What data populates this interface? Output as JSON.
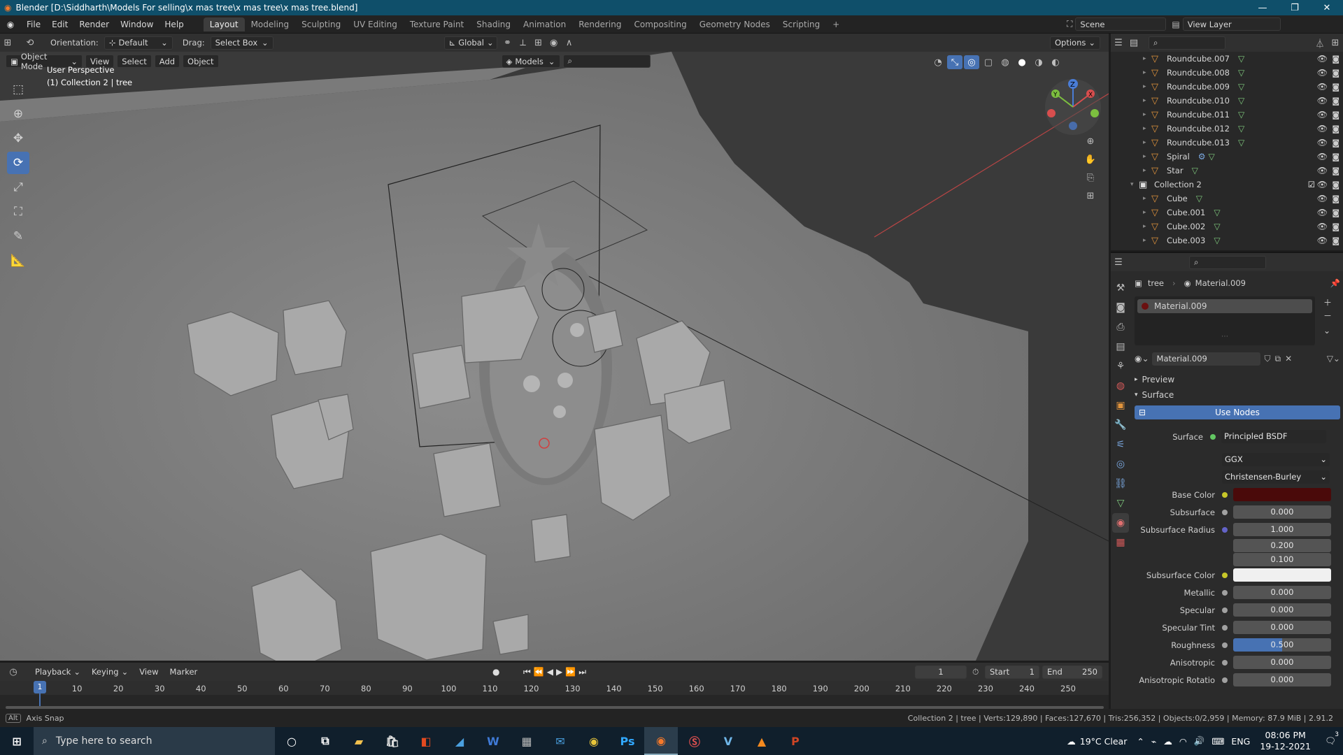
{
  "window": {
    "title": "Blender [D:\\Siddharth\\Models For selling\\x mas tree\\x mas tree\\x mas tree.blend]",
    "minimize": "—",
    "maximize": "❐",
    "close": "✕"
  },
  "menu": {
    "items": [
      "File",
      "Edit",
      "Render",
      "Window",
      "Help"
    ]
  },
  "workspaces": {
    "tabs": [
      "Layout",
      "Modeling",
      "Sculpting",
      "UV Editing",
      "Texture Paint",
      "Shading",
      "Animation",
      "Rendering",
      "Compositing",
      "Geometry Nodes",
      "Scripting"
    ],
    "active": "Layout",
    "add": "+"
  },
  "scene": {
    "label": "Scene",
    "view_layer": "View Layer"
  },
  "tool_header": {
    "orientation_label": "Orientation:",
    "orientation_value": "Default",
    "drag_label": "Drag:",
    "drag_value": "Select Box",
    "transform": "Global",
    "options": "Options"
  },
  "viewport_header": {
    "mode": "Object Mode",
    "view": "View",
    "select": "Select",
    "add": "Add",
    "object": "Object",
    "collection_filter": "Models"
  },
  "viewport": {
    "perspective": "User Perspective",
    "context": "(1) Collection 2 | tree",
    "gizmo_axes": [
      "Z",
      "Y",
      "X"
    ]
  },
  "outliner": {
    "rows": [
      {
        "name": "Roundcube.007",
        "type": "object"
      },
      {
        "name": "Roundcube.008",
        "type": "object"
      },
      {
        "name": "Roundcube.009",
        "type": "object"
      },
      {
        "name": "Roundcube.010",
        "type": "object"
      },
      {
        "name": "Roundcube.011",
        "type": "object"
      },
      {
        "name": "Roundcube.012",
        "type": "object"
      },
      {
        "name": "Roundcube.013",
        "type": "object"
      },
      {
        "name": "Spiral",
        "type": "object"
      },
      {
        "name": "Star",
        "type": "object"
      },
      {
        "name": "Collection 2",
        "type": "collection"
      },
      {
        "name": "Cube",
        "type": "object"
      },
      {
        "name": "Cube.001",
        "type": "object"
      },
      {
        "name": "Cube.002",
        "type": "object"
      },
      {
        "name": "Cube.003",
        "type": "object"
      }
    ]
  },
  "properties": {
    "breadcrumb_object": "tree",
    "breadcrumb_material": "Material.009",
    "slot_name": "Material.009",
    "material_name": "Material.009",
    "preview_label": "Preview",
    "surface_panel": "Surface",
    "use_nodes": "Use Nodes",
    "surface_label": "Surface",
    "surface_value": "Principled BSDF",
    "distribution": "GGX",
    "subsurface_method": "Christensen-Burley",
    "base_color_label": "Base Color",
    "base_color_hex": "#4a0a0a",
    "subsurface_color_hex": "#f0f0f0",
    "fields": [
      {
        "label": "Subsurface",
        "value": "0.000"
      },
      {
        "label": "Subsurface Radius",
        "value": "1.000"
      },
      {
        "label": "",
        "value": "0.200"
      },
      {
        "label": "",
        "value": "0.100"
      },
      {
        "label": "Subsurface Color",
        "value": ""
      },
      {
        "label": "Metallic",
        "value": "0.000"
      },
      {
        "label": "Specular",
        "value": "0.000"
      },
      {
        "label": "Specular Tint",
        "value": "0.000"
      },
      {
        "label": "Roughness",
        "value": "0.500"
      },
      {
        "label": "Anisotropic",
        "value": "0.000"
      },
      {
        "label": "Anisotropic Rotatio",
        "value": "0.000"
      }
    ]
  },
  "timeline": {
    "playback": "Playback",
    "keying": "Keying",
    "view": "View",
    "marker": "Marker",
    "current_frame": "1",
    "start_label": "Start",
    "start": "1",
    "end_label": "End",
    "end": "250",
    "ticks": [
      "1",
      "10",
      "20",
      "30",
      "40",
      "50",
      "60",
      "70",
      "80",
      "90",
      "100",
      "110",
      "120",
      "130",
      "140",
      "150",
      "160",
      "170",
      "180",
      "190",
      "200",
      "210",
      "220",
      "230",
      "240",
      "250"
    ]
  },
  "statusbar": {
    "left": "Axis Snap",
    "key": "Alt",
    "right": "Collection 2 | tree | Verts:129,890 | Faces:127,670 | Tris:256,352 | Objects:0/2,959 | Memory: 87.9 MiB | 2.91.2"
  },
  "taskbar": {
    "search_placeholder": "Type here to search",
    "weather": "19°C  Clear",
    "lang": "ENG",
    "time": "08:06 PM",
    "date": "19-12-2021",
    "notifications": "3"
  }
}
